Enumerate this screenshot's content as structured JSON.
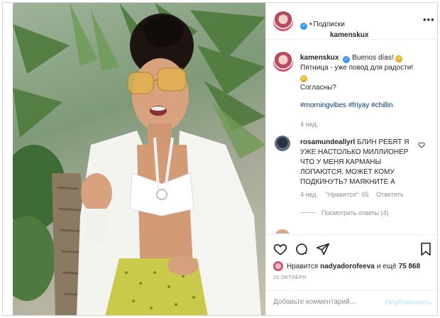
{
  "post": {
    "username": "kamenskux",
    "verified_icon": "verified-badge-icon",
    "follow_label": "Подписки",
    "more_icon": "ellipsis-icon"
  },
  "caption": {
    "username": "kamenskux",
    "line1": "Buenos días!",
    "line2": "Пятница - уже повод для радости!",
    "line3": "Согласны?",
    "emoji_icon": "smiling-face-icon",
    "hashtags": "#morningvibes #friyay #chillin",
    "time": "4 нед."
  },
  "comment": {
    "username": "rosamundeallyrl",
    "text": "БЛИН РЕБЯТ Я УЖЕ НАСТОЛЬКО МИЛЛИОНЕР ЧТО У МЕНЯ КАРМАНЫ ЛОПАЮТСЯ. МОЖЕТ КОМУ ПОДКИНУТЬ? МАЯКНИТЕ А",
    "time": "4 нед.",
    "likes": "\"Нравится\": 65",
    "reply_label": "Ответить",
    "view_replies": "Посмотреть ответы (4)"
  },
  "actions": {
    "like_icon": "heart-icon",
    "comment_icon": "comment-bubble-icon",
    "share_icon": "paper-plane-icon",
    "save_icon": "bookmark-icon"
  },
  "likes": {
    "prefix": "Нравится",
    "user": "nadyadorofeeva",
    "middle": "и ещё",
    "count": "75 868"
  },
  "date": "16 ОКТЯБРЯ",
  "add_comment": {
    "placeholder": "Добавьте комментарий...",
    "publish_label": "Опубликовать"
  },
  "colors": {
    "link": "#00376b",
    "verified": "#3897f0",
    "muted": "#8e8e8e",
    "publish_disabled": "#b2dffc"
  }
}
